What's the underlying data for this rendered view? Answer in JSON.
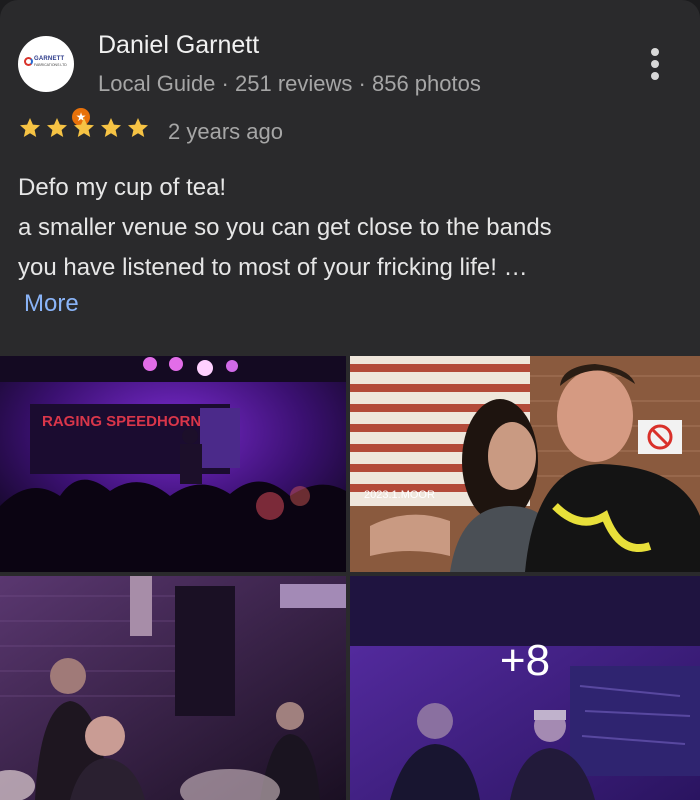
{
  "review": {
    "author": {
      "name": "Daniel Garnett",
      "badge_label": "Local Guide",
      "reviews_count": "251 reviews",
      "photos_count": "856 photos",
      "meta_separator": "·",
      "avatar_logo_text": "GARNETT",
      "avatar_logo_subtext": "FABRICATIONS LTD"
    },
    "rating": 5,
    "rating_max": 5,
    "time_ago": "2 years ago",
    "text_lines": [
      "Defo my cup of tea!",
      "a smaller venue so you can get close to the bands",
      "you have listened to most of your fricking life! …"
    ],
    "more_label": "More"
  },
  "photos": {
    "items": [
      {
        "subject": "concert stage",
        "banner_text": "RAGING SPEEDHORN"
      },
      {
        "subject": "selfie couple",
        "poster_text": "2023.1.MOOR"
      },
      {
        "subject": "crowd near brick wall"
      },
      {
        "subject": "band on stage"
      }
    ],
    "overlay_count": "+8"
  },
  "colors": {
    "background": "#1c1c1e",
    "card": "#2a2a2c",
    "star": "#f6c344",
    "link": "#8ab4f8",
    "guide_badge": "#e8710a"
  },
  "icons": {
    "more": "more-vert-icon",
    "star": "star-icon",
    "guide_badge": "local-guide-star-icon"
  }
}
